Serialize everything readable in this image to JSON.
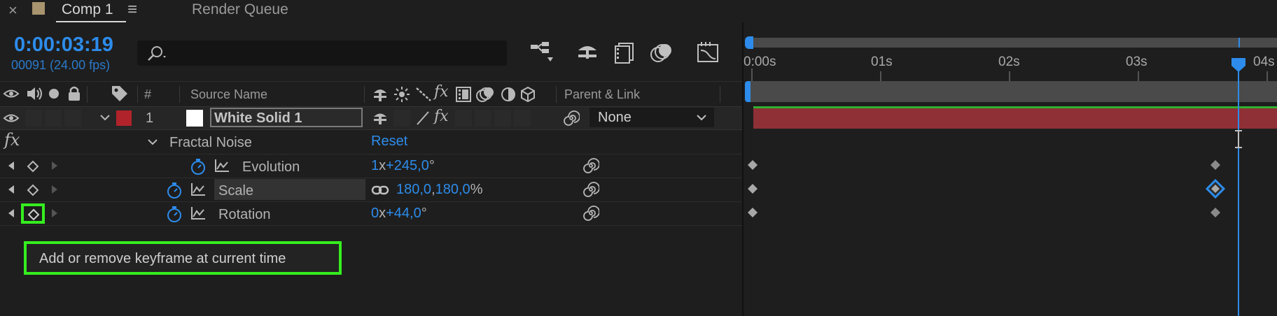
{
  "tabs": {
    "close_glyph": "×",
    "comp_label": "Comp 1",
    "menu_glyph": "≡",
    "render_queue_label": "Render Queue"
  },
  "timecode": {
    "time": "0:00:03:19",
    "frame_info": "00091 (24.00 fps)"
  },
  "search": {
    "placeholder": "",
    "value": ""
  },
  "columns": {
    "hash": "#",
    "source_name": "Source Name",
    "parent_link": "Parent & Link"
  },
  "layer": {
    "number": "1",
    "name": "White Solid 1",
    "label_color": "#b0232a",
    "parent_value": "None"
  },
  "effect": {
    "fx_glyph": "fx",
    "name": "Fractal Noise",
    "reset_label": "Reset"
  },
  "properties": [
    {
      "name": "Evolution",
      "value_a": "1",
      "sep_a": "x",
      "value_b": "+245,0",
      "unit": "°"
    },
    {
      "name": "Scale",
      "value_a": "180,0",
      "sep_a": ",",
      "value_b": "180,0",
      "unit": "%"
    },
    {
      "name": "Rotation",
      "value_a": "0",
      "sep_a": "x",
      "value_b": "+44,0",
      "unit": "°"
    }
  ],
  "tooltip": {
    "text": "Add or remove keyframe at current time"
  },
  "timeline": {
    "ruler_labels": [
      "0:00s",
      "01s",
      "02s",
      "03s",
      "04s"
    ],
    "current_time_seconds": 3.79
  },
  "colors": {
    "accent_blue": "#2d8ceb",
    "highlight_green": "#35ee1f",
    "layer_bar": "#8f2f36",
    "work_area_green": "#2fb02f"
  }
}
